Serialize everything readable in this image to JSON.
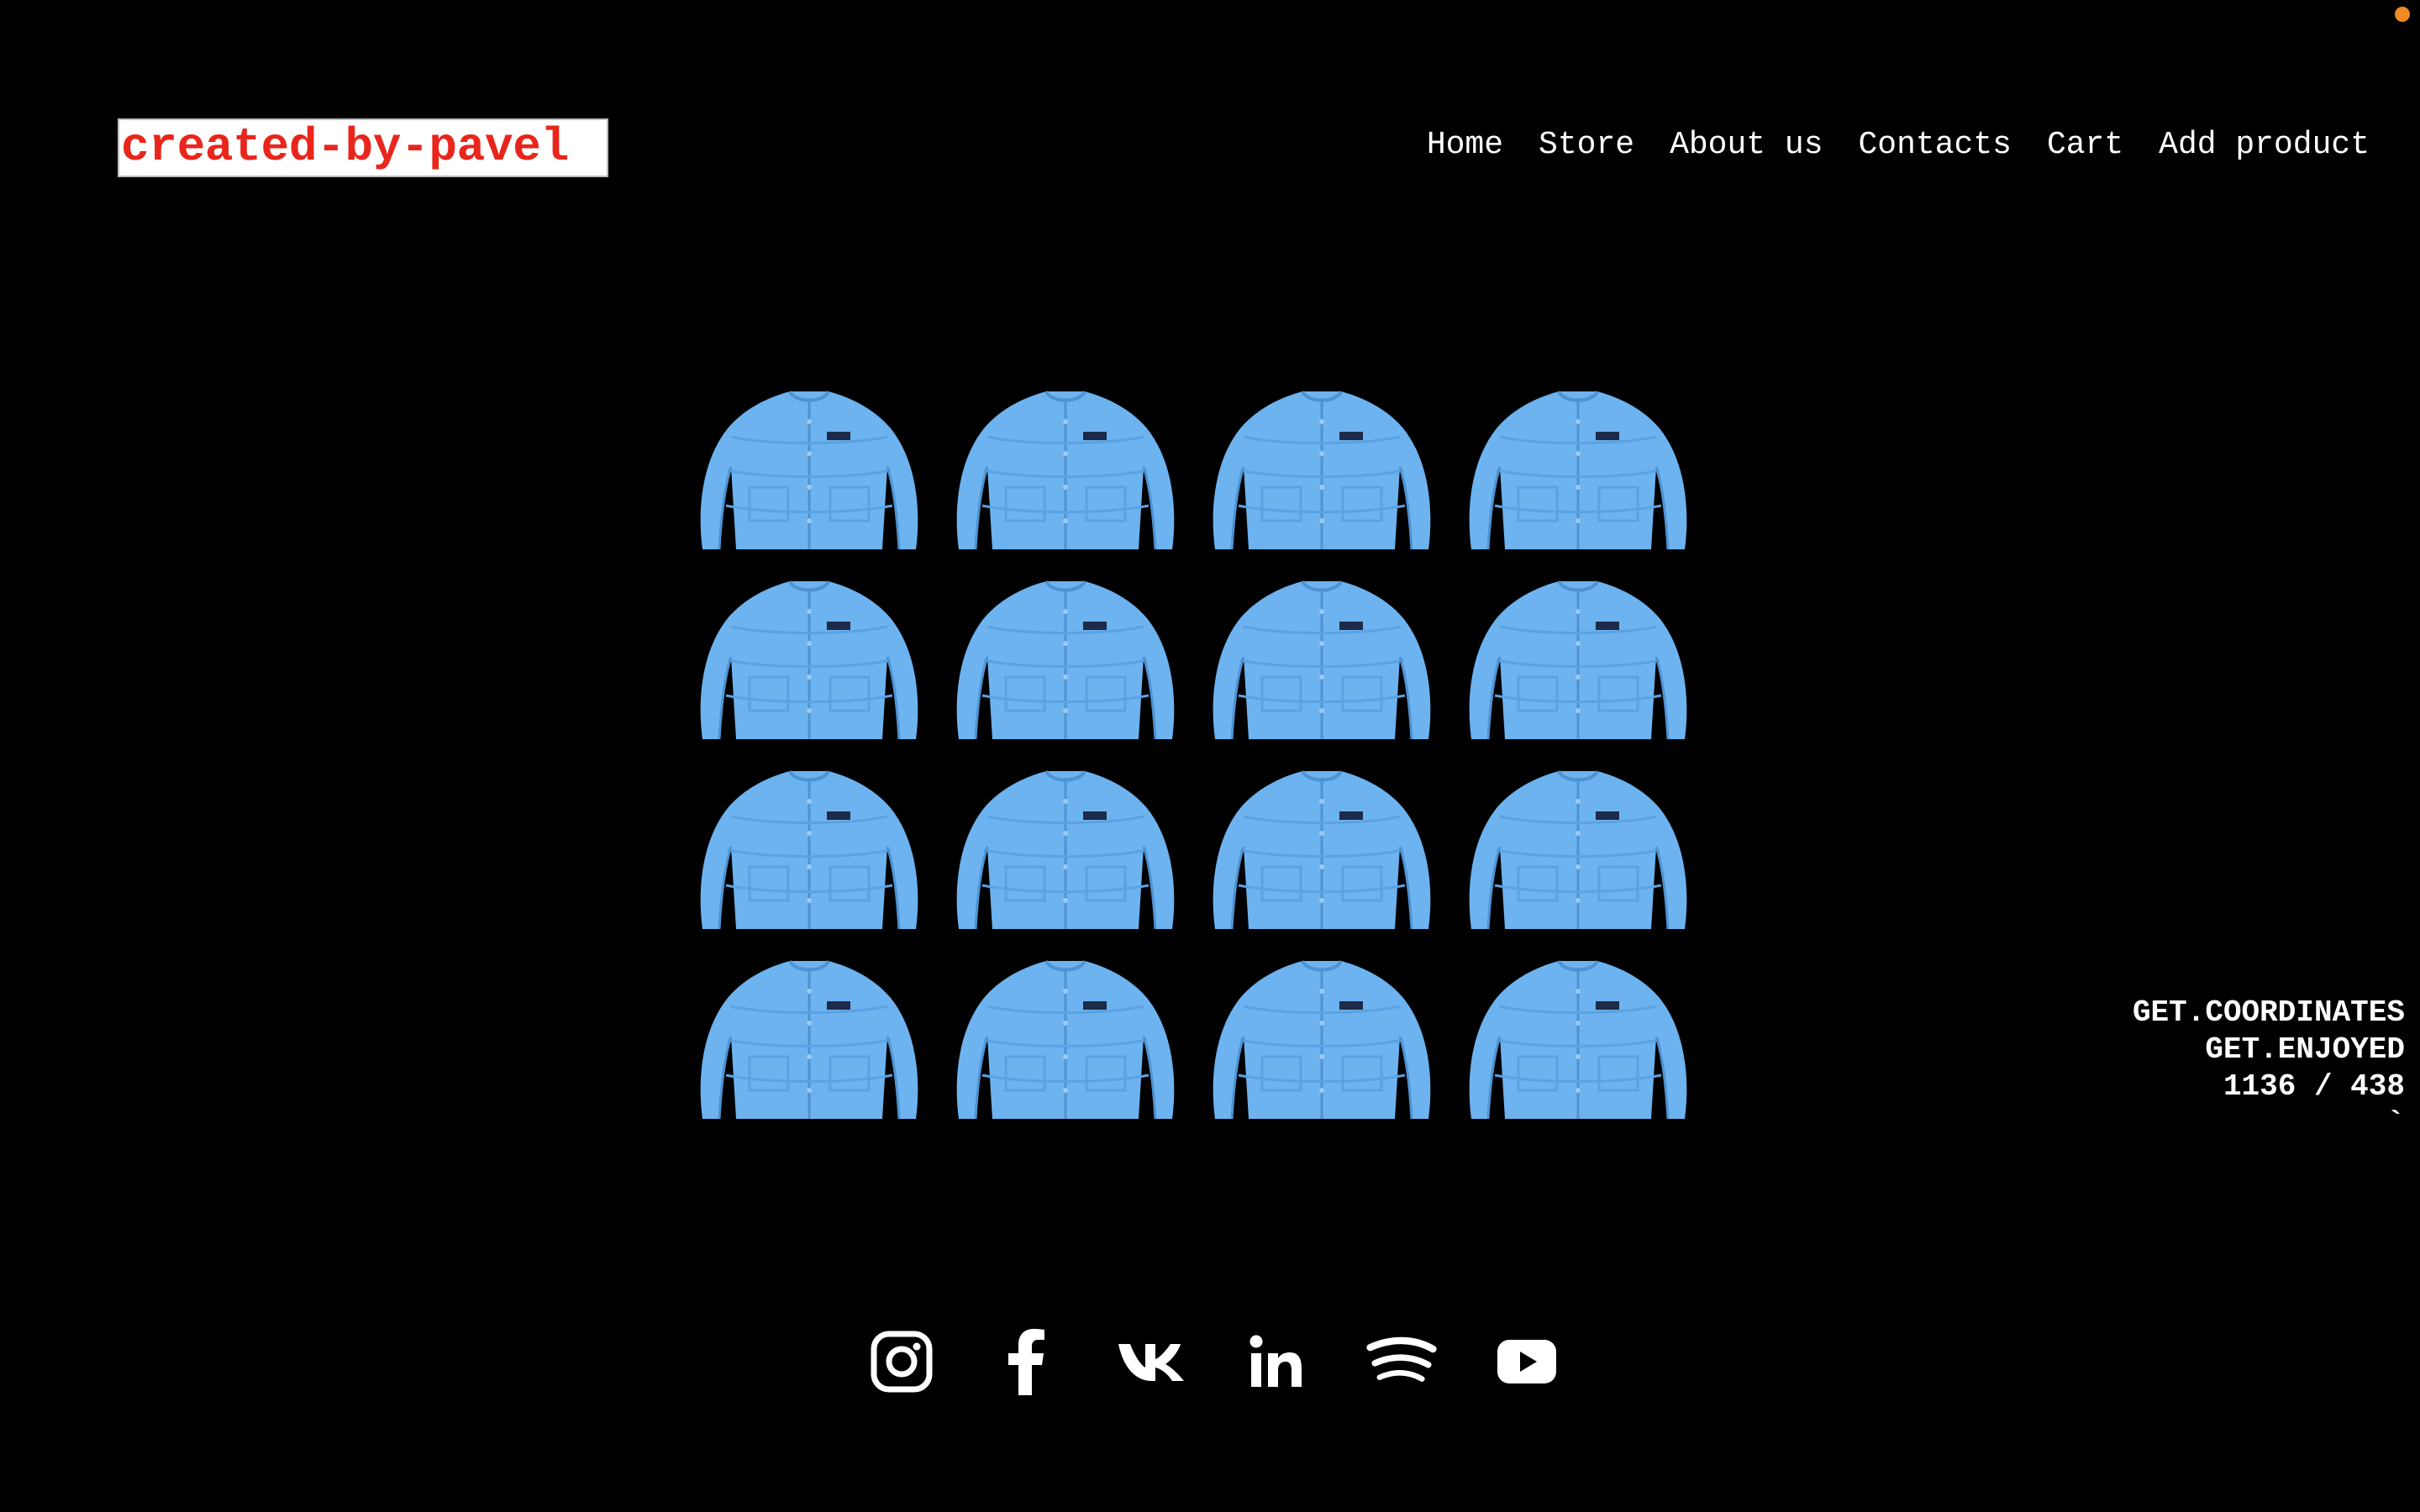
{
  "brand": {
    "logo_text": "created-by-pavel"
  },
  "nav": {
    "items": [
      {
        "label": "Home"
      },
      {
        "label": "Store"
      },
      {
        "label": "About us"
      },
      {
        "label": "Contacts"
      },
      {
        "label": "Cart"
      },
      {
        "label": "Add product"
      }
    ]
  },
  "gallery": {
    "product_image": "blue-puffer-jacket",
    "tiles": 16,
    "colors": {
      "jacket": "#6cb3f0",
      "background": "#000000"
    }
  },
  "coordinates": {
    "line1": "GET.COORDINATES",
    "line2": "GET.ENJOYED",
    "value": "1136 / 438",
    "mark": "`"
  },
  "social": {
    "icons": [
      "instagram-icon",
      "facebook-icon",
      "vk-icon",
      "linkedin-icon",
      "spotify-icon",
      "youtube-icon"
    ]
  },
  "colors": {
    "logo_text": "#e8261c",
    "logo_bg": "#ffffff",
    "record_dot": "#f08a24"
  }
}
